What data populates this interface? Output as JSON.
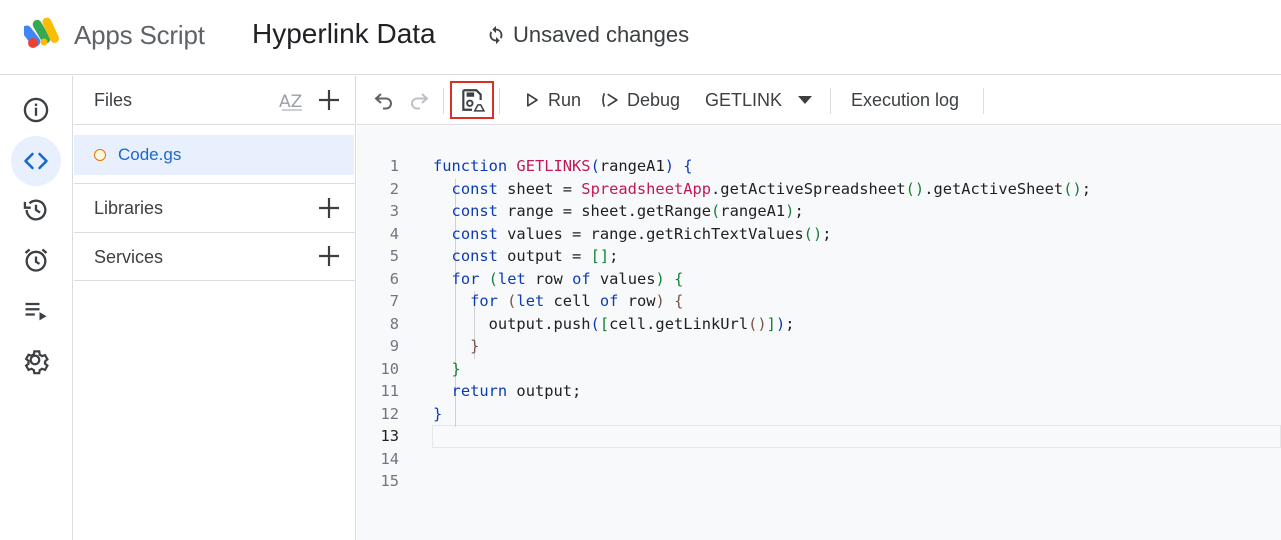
{
  "header": {
    "app_name": "Apps Script",
    "project_title": "Hyperlink Data",
    "save_status": "Unsaved changes"
  },
  "rail": {
    "items": [
      {
        "icon": "info-icon",
        "label": "Overview"
      },
      {
        "icon": "code-icon",
        "label": "Editor",
        "active": true
      },
      {
        "icon": "history-icon",
        "label": "Project history"
      },
      {
        "icon": "alarm-icon",
        "label": "Triggers"
      },
      {
        "icon": "executions-icon",
        "label": "Executions"
      },
      {
        "icon": "gear-icon",
        "label": "Project Settings"
      }
    ]
  },
  "files_panel": {
    "files_label": "Files",
    "files": [
      {
        "name": "Code.gs",
        "selected": true
      }
    ],
    "libraries_label": "Libraries",
    "services_label": "Services"
  },
  "toolbar": {
    "run_label": "Run",
    "debug_label": "Debug",
    "function_selected": "GETLINK",
    "execution_log_label": "Execution log"
  },
  "editor": {
    "line_numbers": [
      "1",
      "2",
      "3",
      "4",
      "5",
      "6",
      "7",
      "8",
      "9",
      "10",
      "11",
      "12",
      "13",
      "14",
      "15"
    ],
    "current_line": 13,
    "lines": [
      "function GETLINKS(rangeA1) {",
      "  const sheet = SpreadsheetApp.getActiveSpreadsheet().getActiveSheet();",
      "  const range = sheet.getRange(rangeA1);",
      "  const values = range.getRichTextValues();",
      "  const output = [];",
      "  for (let row of values) {",
      "    for (let cell of row) {",
      "      output.push([cell.getLinkUrl()]);",
      "    }",
      "  }",
      "  return output;",
      "}",
      "",
      "",
      ""
    ]
  },
  "colors": {
    "accent": "#1a73e8",
    "active_bg": "#e8f0fe",
    "highlight_border": "#d93025",
    "keyword": "#0b3cb4",
    "function_name": "#c2185b"
  }
}
